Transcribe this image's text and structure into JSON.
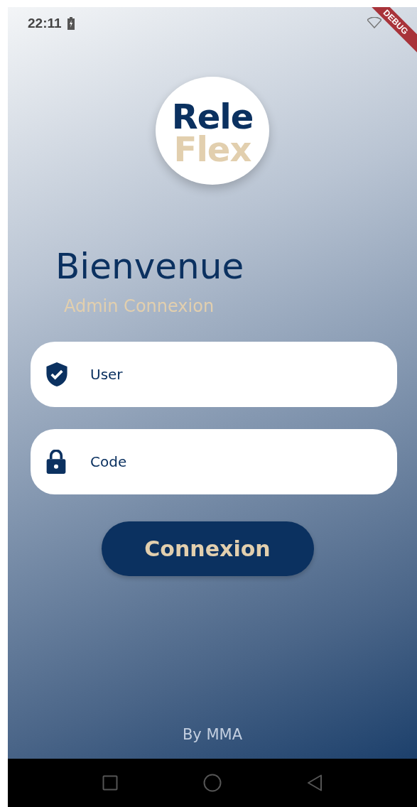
{
  "status_bar": {
    "time": "22:11"
  },
  "debug_banner": {
    "label": "DEBUG"
  },
  "logo": {
    "line_1": "Rele",
    "line_2": "Flex"
  },
  "title": "Bienvenue",
  "subtitle": "Admin Connexion",
  "fields": [
    {
      "kind": "user",
      "placeholder": "User"
    },
    {
      "kind": "code",
      "placeholder": "Code"
    }
  ],
  "login_button": {
    "label": "Connexion"
  },
  "footer": "By MMA"
}
